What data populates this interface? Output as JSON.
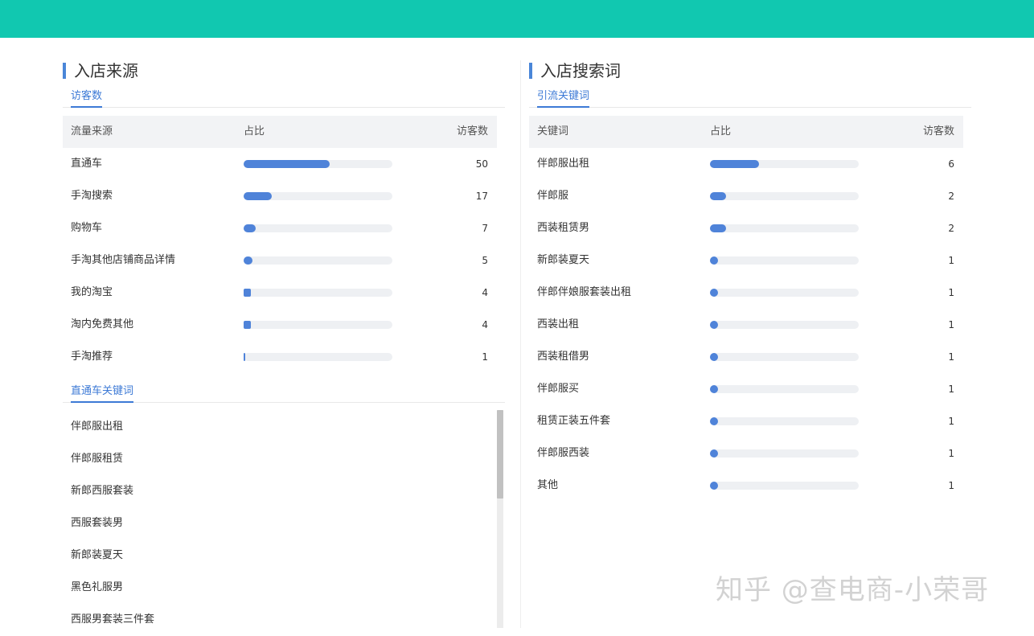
{
  "colors": {
    "header": "#11c8b0",
    "accent": "#4a86d8",
    "bar": "#4f83d9"
  },
  "left": {
    "title": "入店来源",
    "tab": "访客数",
    "columns": {
      "source": "流量来源",
      "ratio": "占比",
      "visitors": "访客数"
    },
    "rows": [
      {
        "name": "直通车",
        "value": "50",
        "ratio": 0.58
      },
      {
        "name": "手淘搜索",
        "value": "17",
        "ratio": 0.19
      },
      {
        "name": "购物车",
        "value": "7",
        "ratio": 0.08
      },
      {
        "name": "手淘其他店铺商品详情",
        "value": "5",
        "ratio": 0.06
      },
      {
        "name": "我的淘宝",
        "value": "4",
        "ratio": 0.05
      },
      {
        "name": "淘内免费其他",
        "value": "4",
        "ratio": 0.05
      },
      {
        "name": "手淘推荐",
        "value": "1",
        "ratio": 0.01
      }
    ],
    "keyword_tab": "直通车关键词",
    "keywords": [
      "伴郎服出租",
      "伴郎服租赁",
      "新郎西服套装",
      "西服套装男",
      "新郎装夏天",
      "黑色礼服男",
      "西服男套装三件套"
    ]
  },
  "right": {
    "title": "入店搜索词",
    "tab": "引流关键词",
    "columns": {
      "keyword": "关键词",
      "ratio": "占比",
      "visitors": "访客数"
    },
    "rows": [
      {
        "name": "伴郎服出租",
        "value": "6",
        "ratio": 0.33
      },
      {
        "name": "伴郎服",
        "value": "2",
        "ratio": 0.11
      },
      {
        "name": "西装租赁男",
        "value": "2",
        "ratio": 0.11
      },
      {
        "name": "新郎装夏天",
        "value": "1",
        "ratio": 0.055
      },
      {
        "name": "伴郎伴娘服套装出租",
        "value": "1",
        "ratio": 0.055
      },
      {
        "name": "西装出租",
        "value": "1",
        "ratio": 0.055
      },
      {
        "name": "西装租借男",
        "value": "1",
        "ratio": 0.055
      },
      {
        "name": "伴郎服买",
        "value": "1",
        "ratio": 0.055
      },
      {
        "name": "租赁正装五件套",
        "value": "1",
        "ratio": 0.055
      },
      {
        "name": "伴郎服西装",
        "value": "1",
        "ratio": 0.055
      },
      {
        "name": "其他",
        "value": "1",
        "ratio": 0.055
      }
    ]
  },
  "watermark": "知乎 @查电商-小荣哥"
}
